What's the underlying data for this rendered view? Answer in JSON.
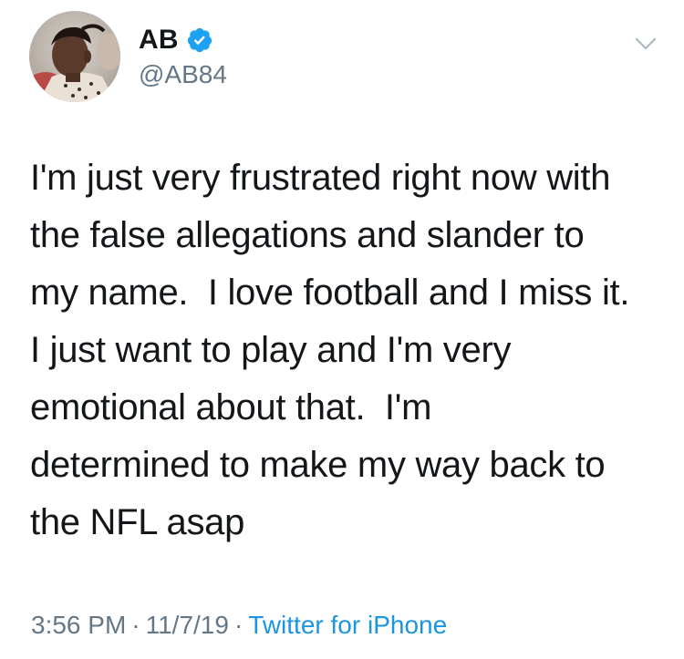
{
  "tweet": {
    "author": {
      "display_name": "AB",
      "handle": "@AB84",
      "verified": true
    },
    "text": "I'm just very frustrated right now with\nthe false allegations and slander to\nmy name.  I love football and I miss it.\nI just want to play and I'm very\nemotional about that.  I'm\ndetermined to make my way back to\nthe NFL asap",
    "time": "3:56 PM",
    "date": "11/7/19",
    "separator": "·",
    "source": "Twitter for iPhone"
  },
  "icons": {
    "verified": "verified-badge-icon",
    "menu": "chevron-down-icon"
  },
  "colors": {
    "text_primary": "#14171a",
    "text_secondary": "#657786",
    "link": "#1b95e0",
    "verified": "#1da1f2"
  }
}
